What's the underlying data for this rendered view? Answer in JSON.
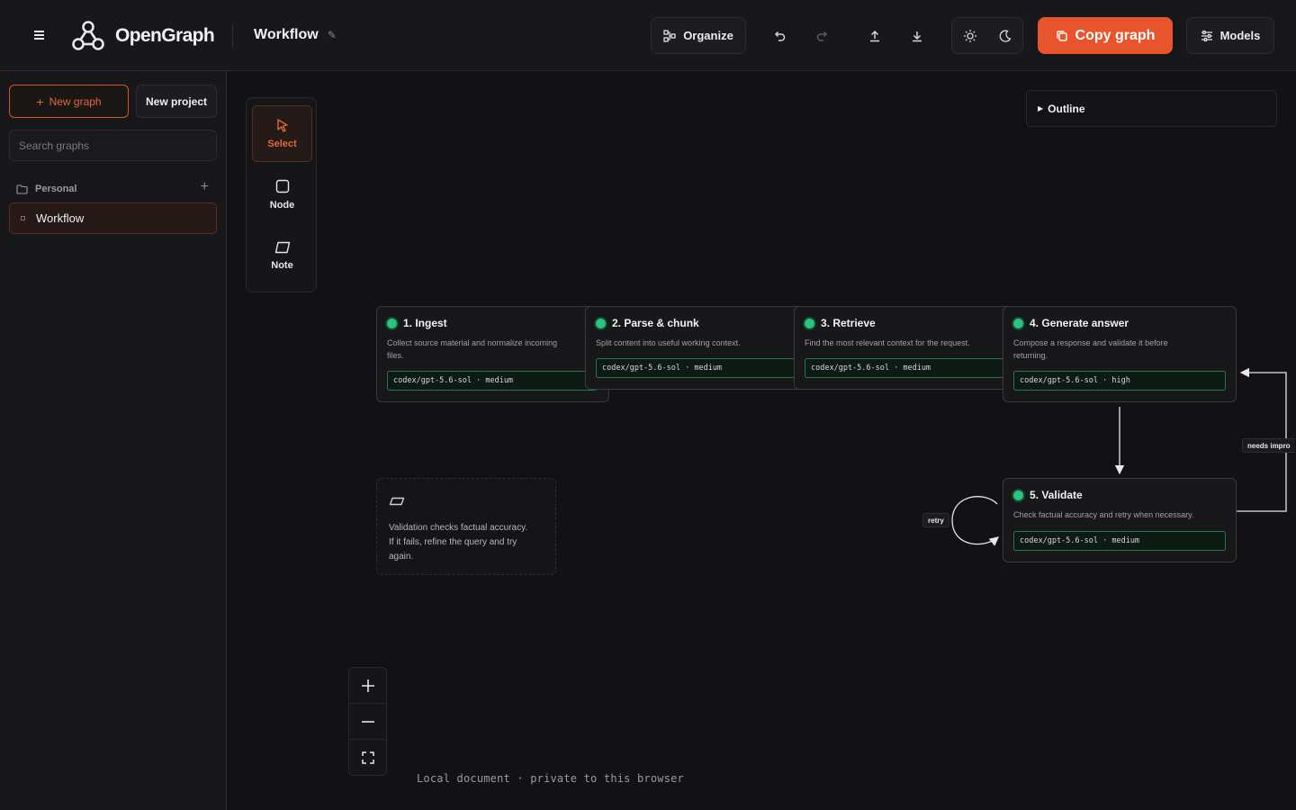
{
  "header": {
    "app_name": "OpenGraph",
    "doc_title": "Workflow",
    "organize_label": "Organize",
    "copy_graph_label": "Copy graph",
    "models_label": "Models"
  },
  "sidebar": {
    "new_graph_label": "New graph",
    "new_project_label": "New project",
    "search_placeholder": "Search graphs",
    "folder_label": "Personal",
    "graphs": [
      "Workflow"
    ]
  },
  "toolbar": {
    "tools": [
      "Select",
      "Node",
      "Note"
    ]
  },
  "outline_label": "Outline",
  "nodes": [
    {
      "title": "1. Ingest",
      "desc": "Collect source material and normalize incoming files.",
      "model": "codex/gpt-5.6-sol · medium"
    },
    {
      "title": "2. Parse & chunk",
      "desc": "Split content into useful working context.",
      "model": "codex/gpt-5.6-sol · medium"
    },
    {
      "title": "3. Retrieve",
      "desc": "Find the most relevant context for the request.",
      "model": "codex/gpt-5.6-sol · medium"
    },
    {
      "title": "4. Generate answer",
      "desc": "Compose a response and validate it before returning.",
      "model": "codex/gpt-5.6-sol · high"
    },
    {
      "title": "5. Validate",
      "desc": "Check factual accuracy and retry when necessary.",
      "model": "codex/gpt-5.6-sol · medium"
    }
  ],
  "note_text": "Validation checks factual accuracy. If it fails, refine the query and try again.",
  "edges": {
    "retry_label": "retry",
    "needs_label": "needs impro"
  },
  "footer": "Local document · private to this browser",
  "colors": {
    "accent": "#e8552c",
    "status": "#2ec27e"
  }
}
